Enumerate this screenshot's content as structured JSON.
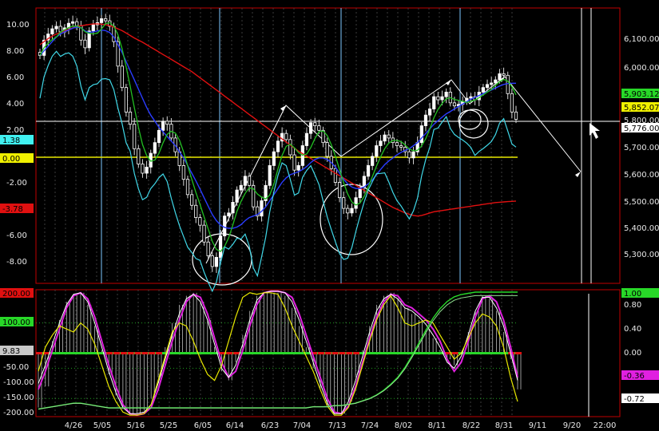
{
  "chart_data": [
    {
      "type": "candlestick",
      "title": "",
      "x_tick_labels": [
        "4/26",
        "5/05",
        "5/16",
        "5/25",
        "6/05",
        "6/14",
        "6/23",
        "7/04",
        "7/13",
        "7/24",
        "8/02",
        "8/11",
        "8/22",
        "8/31",
        "9/11",
        "9/20",
        "22:00"
      ],
      "left_axis_ticks": [
        "10.00",
        "8.00",
        "6.00",
        "4.00",
        "2.00",
        "0.00",
        "-2.00",
        "-4.00",
        "-6.00",
        "-8.00"
      ],
      "right_axis_ticks": [
        "6,100.00",
        "6,000.00",
        "5,900.00",
        "5,800.00",
        "5,700.00",
        "5,600.00",
        "5,500.00",
        "5,400.00",
        "5,300.00"
      ],
      "ylim_left": [
        -8.6,
        10.8
      ],
      "ylim_right": [
        5240,
        6140
      ],
      "badges": {
        "left_cyan": "1.38",
        "left_yellow": "0.00",
        "left_red": "-3.78",
        "right_green": "5,903.12",
        "right_yellow": "5,852.07",
        "right_white": "5,776.00"
      },
      "close": [
        5985,
        6035,
        6055,
        6072,
        6080,
        6062,
        6075,
        6090,
        6095,
        6082,
        6035,
        6010,
        6065,
        6085,
        6092,
        6105,
        6098,
        6080,
        6030,
        5950,
        5880,
        5800,
        5760,
        5680,
        5630,
        5600,
        5620,
        5665,
        5700,
        5740,
        5770,
        5760,
        5715,
        5670,
        5625,
        5580,
        5530,
        5495,
        5455,
        5430,
        5375,
        5330,
        5295,
        5325,
        5395,
        5460,
        5470,
        5505,
        5545,
        5560,
        5590,
        5560,
        5490,
        5460,
        5510,
        5560,
        5625,
        5670,
        5705,
        5730,
        5710,
        5660,
        5610,
        5625,
        5690,
        5730,
        5765,
        5755,
        5740,
        5700,
        5655,
        5615,
        5570,
        5520,
        5485,
        5470,
        5485,
        5520,
        5555,
        5590,
        5625,
        5655,
        5690,
        5705,
        5725,
        5715,
        5700,
        5690,
        5685,
        5670,
        5650,
        5670,
        5700,
        5755,
        5790,
        5810,
        5850,
        5840,
        5850,
        5865,
        5830,
        5820,
        5825,
        5835,
        5845,
        5850,
        5840,
        5865,
        5880,
        5890,
        5895,
        5905,
        5925,
        5920,
        5860,
        5800,
        5776
      ],
      "red_ma": [
        6020,
        6030,
        6040,
        6048,
        6055,
        6060,
        6065,
        6070,
        6075,
        6080,
        6082,
        6084,
        6086,
        6088,
        6088,
        6087,
        6085,
        6082,
        6078,
        6072,
        6066,
        6058,
        6050,
        6042,
        6035,
        6028,
        6020,
        6012,
        6004,
        5996,
        5988,
        5980,
        5972,
        5964,
        5956,
        5948,
        5940,
        5932,
        5922,
        5912,
        5902,
        5892,
        5882,
        5872,
        5862,
        5852,
        5842,
        5832,
        5822,
        5812,
        5802,
        5792,
        5782,
        5772,
        5762,
        5752,
        5742,
        5732,
        5722,
        5712,
        5702,
        5692,
        5682,
        5672,
        5664,
        5656,
        5648,
        5640,
        5632,
        5624,
        5616,
        5608,
        5600,
        5592,
        5584,
        5576,
        5568,
        5560,
        5552,
        5544,
        5536,
        5528,
        5520,
        5512,
        5504,
        5496,
        5488,
        5482,
        5476,
        5470,
        5466,
        5462,
        5460,
        5462,
        5466,
        5470,
        5474,
        5476,
        5478,
        5480,
        5482,
        5484,
        5486,
        5488,
        5490,
        5492,
        5494,
        5496,
        5498,
        5500,
        5502,
        5504,
        5505,
        5506,
        5507,
        5508,
        5509
      ],
      "blue_ma": [
        5985,
        6000,
        6015,
        6030,
        6045,
        6055,
        6062,
        6068,
        6074,
        6078,
        6075,
        6065,
        6060,
        6062,
        6065,
        6068,
        6066,
        6060,
        6045,
        6020,
        5995,
        5965,
        5935,
        5905,
        5875,
        5845,
        5815,
        5790,
        5770,
        5750,
        5735,
        5720,
        5705,
        5690,
        5670,
        5650,
        5625,
        5600,
        5575,
        5548,
        5520,
        5492,
        5465,
        5445,
        5430,
        5423,
        5420,
        5420,
        5424,
        5432,
        5445,
        5455,
        5460,
        5465,
        5475,
        5490,
        5510,
        5530,
        5550,
        5570,
        5585,
        5595,
        5600,
        5605,
        5612,
        5622,
        5635,
        5645,
        5650,
        5650,
        5645,
        5635,
        5620,
        5600,
        5580,
        5565,
        5555,
        5550,
        5550,
        5555,
        5565,
        5578,
        5595,
        5612,
        5628,
        5640,
        5650,
        5660,
        5668,
        5675,
        5680,
        5690,
        5700,
        5715,
        5730,
        5745,
        5760,
        5772,
        5783,
        5794,
        5802,
        5810,
        5818,
        5826,
        5834,
        5842,
        5848,
        5854,
        5860,
        5866,
        5872,
        5878,
        5885,
        5890,
        5893,
        5894,
        5894
      ]
    },
    {
      "type": "oscillator",
      "title": "",
      "left_axis_ticks": [
        "200.00",
        "100.00",
        "9.83",
        "-50.00",
        "-100.00",
        "-150.00",
        "-200.00"
      ],
      "right_axis_ticks": [
        "1.00",
        "0.80",
        "0.40",
        "0.00",
        "-0.36",
        "-0.72"
      ],
      "ylim_left": [
        -210,
        210
      ],
      "badges": {
        "left_red": "200.00",
        "left_green": "100.00",
        "left_white": "9.83",
        "right_green": "1.00",
        "right_magenta": "-0.36",
        "right_white": "-0.72"
      },
      "magenta": [
        -120,
        -60,
        10,
        80,
        150,
        190,
        200,
        180,
        120,
        40,
        -40,
        -110,
        -170,
        -200,
        -205,
        -200,
        -180,
        -120,
        -40,
        40,
        110,
        170,
        195,
        185,
        130,
        50,
        -30,
        -80,
        -60,
        10,
        90,
        160,
        200,
        205,
        205,
        200,
        185,
        130,
        60,
        -10,
        -80,
        -150,
        -195,
        -200,
        -175,
        -110,
        -30,
        50,
        120,
        170,
        195,
        190,
        160,
        150,
        130,
        110,
        80,
        40,
        -20,
        -60,
        -30,
        40,
        120,
        180,
        190,
        170,
        110,
        20,
        -80
      ],
      "white": [
        -100,
        -40,
        30,
        100,
        160,
        195,
        200,
        170,
        100,
        20,
        -60,
        -130,
        -180,
        -200,
        -200,
        -195,
        -170,
        -100,
        -20,
        60,
        130,
        180,
        195,
        170,
        110,
        30,
        -50,
        -80,
        -40,
        30,
        110,
        175,
        200,
        205,
        205,
        200,
        170,
        110,
        40,
        -30,
        -100,
        -165,
        -200,
        -200,
        -160,
        -90,
        -10,
        70,
        140,
        180,
        195,
        180,
        150,
        140,
        120,
        95,
        60,
        20,
        -30,
        -50,
        -10,
        60,
        140,
        185,
        185,
        150,
        90,
        0,
        -90
      ],
      "yellow": [
        -60,
        20,
        60,
        90,
        80,
        70,
        100,
        80,
        30,
        -40,
        -110,
        -160,
        -195,
        -205,
        -205,
        -200,
        -170,
        -90,
        -10,
        70,
        100,
        90,
        40,
        -20,
        -70,
        -90,
        -40,
        40,
        120,
        185,
        200,
        195,
        200,
        200,
        195,
        150,
        90,
        40,
        -10,
        -60,
        -120,
        -175,
        -205,
        -205,
        -180,
        -120,
        -40,
        40,
        110,
        160,
        190,
        150,
        100,
        90,
        100,
        110,
        100,
        60,
        20,
        -20,
        0,
        50,
        100,
        130,
        120,
        90,
        20,
        -80,
        -160
      ],
      "hist": [
        -180,
        -110,
        40,
        110,
        170,
        195,
        200,
        160,
        90,
        10,
        -70,
        -140,
        -185,
        -200,
        -200,
        -190,
        -150,
        -80,
        20,
        100,
        160,
        190,
        200,
        170,
        110,
        20,
        -60,
        -90,
        -30,
        60,
        140,
        190,
        200,
        200,
        200,
        190,
        150,
        90,
        20,
        -50,
        -120,
        -175,
        -200,
        -200,
        -160,
        -80,
        10,
        90,
        160,
        190,
        200,
        180,
        150,
        130,
        110,
        80,
        50,
        10,
        -20,
        -40,
        0,
        70,
        140,
        190,
        180,
        140,
        70,
        -20,
        -120
      ],
      "green_long": [
        0.01,
        0.02,
        0.03,
        0.04,
        0.05,
        0.06,
        0.06,
        0.05,
        0.04,
        0.03,
        0.02,
        0.02,
        0.02,
        0.02,
        0.02,
        0.02,
        0.02,
        0.02,
        0.02,
        0.02,
        0.02,
        0.02,
        0.02,
        0.02,
        0.02,
        0.02,
        0.02,
        0.02,
        0.02,
        0.02,
        0.02,
        0.02,
        0.02,
        0.02,
        0.02,
        0.02,
        0.02,
        0.02,
        0.02,
        0.03,
        0.03,
        0.03,
        0.04,
        0.04,
        0.05,
        0.06,
        0.08,
        0.1,
        0.13,
        0.17,
        0.22,
        0.28,
        0.36,
        0.46,
        0.57,
        0.68,
        0.78,
        0.86,
        0.92,
        0.96,
        0.98,
        0.99,
        1.0,
        1.0,
        1.0,
        1.0,
        1.0,
        1.0,
        1.0
      ]
    }
  ]
}
